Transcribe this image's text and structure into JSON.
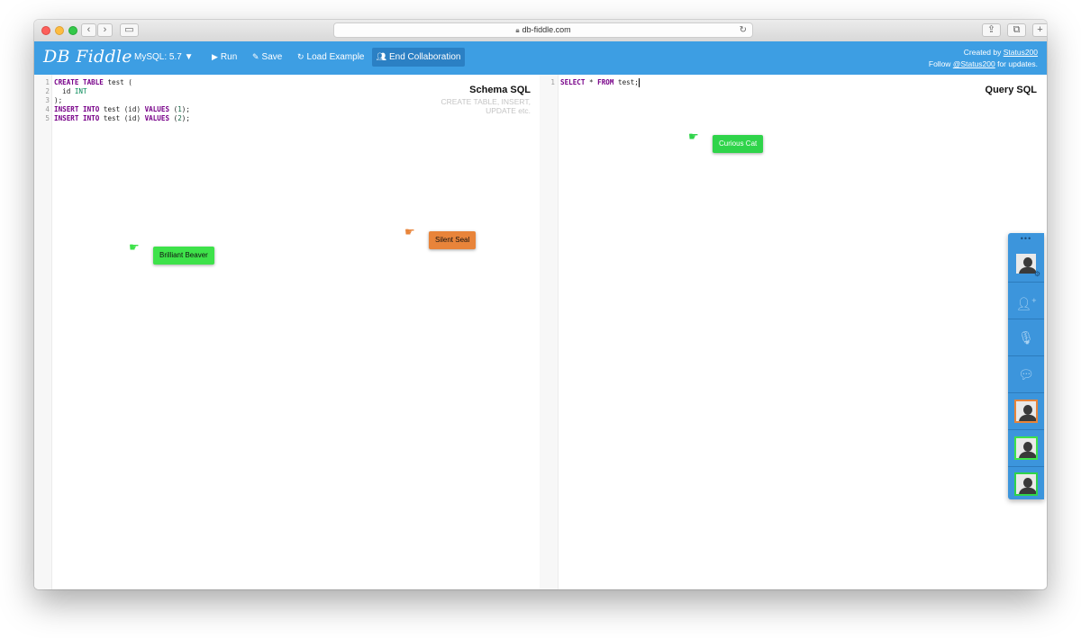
{
  "browser": {
    "url": "db-fiddle.com"
  },
  "header": {
    "logo": "DB Fiddle",
    "db_version": "MySQL: 5.7 ▼",
    "run_label": "Run",
    "save_label": "Save",
    "load_example_label": "Load Example",
    "end_collab_label": "End Collaboration",
    "credits_line1_prefix": "Created by ",
    "credits_line1_link": "Status200",
    "credits_line2_prefix": "Follow ",
    "credits_line2_link": "@Status200",
    "credits_line2_suffix": " for updates."
  },
  "schema_panel": {
    "title": "Schema SQL",
    "hint": "CREATE TABLE, INSERT, UPDATE etc.",
    "line_numbers": [
      "1",
      "2",
      "3",
      "4",
      "5"
    ],
    "lines": [
      "CREATE TABLE test (",
      "  id INT",
      ");",
      "INSERT INTO test (id) VALUES (1);",
      "INSERT INTO test (id) VALUES (2);"
    ]
  },
  "query_panel": {
    "title": "Query SQL",
    "line_numbers": [
      "1"
    ],
    "lines": [
      "SELECT * FROM test;"
    ]
  },
  "collaborators": [
    {
      "name": "Brilliant Beaver",
      "color": "#3ee24a"
    },
    {
      "name": "Silent Seal",
      "color": "#e8843a"
    },
    {
      "name": "Curious Cat",
      "color": "#2fd44a"
    }
  ],
  "dock": {
    "menu_dots": "•••",
    "icons": [
      "self-avatar-icon",
      "invite-icon",
      "microphone-icon",
      "chat-icon"
    ],
    "participant_colors": [
      "#e8843a",
      "#3ee24a",
      "#2fd44a"
    ],
    "colors": {
      "dock_bg": "#3c95dc",
      "header_bg": "#3d9ee3",
      "collab_btn_bg": "#2b80c4"
    }
  }
}
